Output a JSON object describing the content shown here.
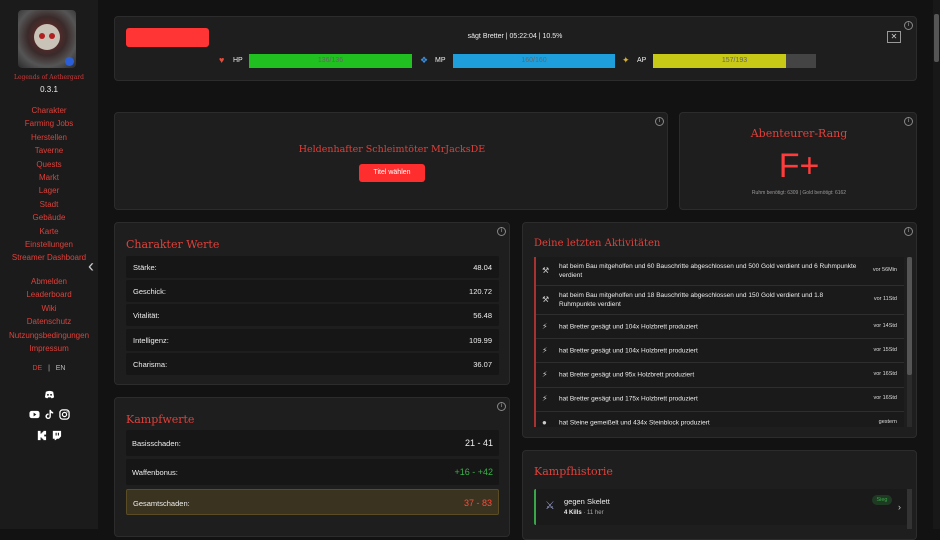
{
  "app": {
    "name": "Legends of Aethergard",
    "version": "0.3.1"
  },
  "nav": {
    "main": [
      "Charakter",
      "Farming Jobs",
      "Herstellen",
      "Taverne",
      "Quests",
      "Markt",
      "Lager",
      "Stadt",
      "Gebäude",
      "Karte",
      "Einstellungen",
      "Streamer Dashboard"
    ],
    "secondary": [
      "Abmelden",
      "Leaderboard",
      "Wiki",
      "Datenschutz",
      "Nutzungsbedingungen",
      "Impressum"
    ]
  },
  "language": {
    "de": "DE",
    "separator": "|",
    "en": "EN"
  },
  "social": {
    "discord": "discord-icon",
    "youtube": "youtube-icon",
    "tiktok": "tiktok-icon",
    "instagram": "instagram-icon",
    "kick": "kick-icon",
    "twitch": "twitch-icon"
  },
  "topbar": {
    "status": "sägt Bretter | 05:22:04 | 10.5%",
    "close": "✕",
    "hp": {
      "label": "HP",
      "value": "136/136",
      "percent": 100,
      "color": "#20c020"
    },
    "mp": {
      "label": "MP",
      "value": "160/160",
      "percent": 100,
      "color": "#1e9fdc"
    },
    "ap": {
      "label": "AP",
      "value": "157/193",
      "percent": 81.3,
      "color": "#c8c816"
    }
  },
  "title_card": {
    "title": "Heldenhafter Schleimtöter  MrJacksDE",
    "button": "Titel wählen"
  },
  "rank_card": {
    "heading": "Abenteurer-Rang",
    "grade": "F+",
    "footer": "Ruhm benötigt: 6309  |  Gold benötigt: 6162"
  },
  "character_stats": {
    "heading": "Charakter Werte",
    "rows": [
      {
        "label": "Stärke:",
        "value": "48.04"
      },
      {
        "label": "Geschick:",
        "value": "120.72"
      },
      {
        "label": "Vitalität:",
        "value": "56.48"
      },
      {
        "label": "Intelligenz:",
        "value": "109.99"
      },
      {
        "label": "Charisma:",
        "value": "36.07"
      }
    ]
  },
  "combat_stats": {
    "heading": "Kampfwerte",
    "rows": [
      {
        "label": "Basisschaden:",
        "value": "21 - 41",
        "color": "#eeeeee"
      },
      {
        "label": "Waffenbonus:",
        "value": "+16 - +42",
        "color": "#3ab14a"
      },
      {
        "label": "Gesamtschaden:",
        "value": "37 - 83",
        "color": "#ff4a3a"
      }
    ]
  },
  "activities": {
    "heading": "Deine letzten Aktivitäten",
    "items": [
      {
        "icon": "pickaxe-icon",
        "text": "hat beim Bau mitgeholfen und 60 Bauschritte abgeschlossen und 500 Gold verdient und 6 Ruhmpunkte verdient",
        "time": "vor 56Min"
      },
      {
        "icon": "pickaxe-icon",
        "text": "hat beim Bau mitgeholfen und 18 Bauschritte abgeschlossen und 150 Gold verdient und 1.8 Ruhmpunkte verdient",
        "time": "vor 11Std"
      },
      {
        "icon": "saw-icon",
        "text": "hat Bretter gesägt und 104x Holzbrett produziert",
        "time": "vor 14Std"
      },
      {
        "icon": "saw-icon",
        "text": "hat Bretter gesägt und 104x Holzbrett produziert",
        "time": "vor 15Std"
      },
      {
        "icon": "saw-icon",
        "text": "hat Bretter gesägt und 95x Holzbrett produziert",
        "time": "vor 16Std"
      },
      {
        "icon": "saw-icon",
        "text": "hat Bretter gesägt und 175x Holzbrett produziert",
        "time": "vor 16Std"
      },
      {
        "icon": "stone-icon",
        "text": "hat Steine gemeißelt und 434x Steinblock produziert",
        "time": "gestern"
      }
    ]
  },
  "combat_history": {
    "heading": "Kampfhistorie",
    "items": [
      {
        "icon": "crossed-swords-icon",
        "title": "gegen Skelett",
        "kills": "4 Kills",
        "sep": " · ",
        "time": "11 her",
        "badge": "Sieg",
        "chevron": "›"
      }
    ]
  }
}
